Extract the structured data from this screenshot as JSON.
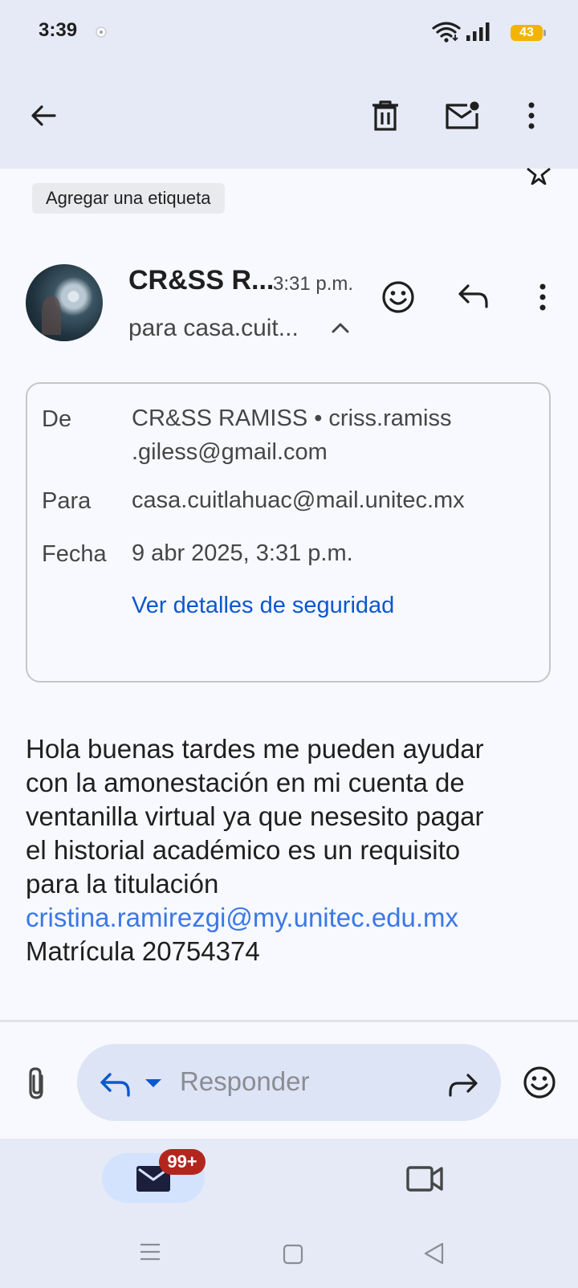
{
  "status_bar": {
    "time": "3:39",
    "battery": "43"
  },
  "toolbar": {
    "back_icon": "arrow-left-icon",
    "delete_icon": "trash-icon",
    "mark_unread_icon": "mail-unread-icon",
    "more_icon": "more-vertical-icon"
  },
  "email": {
    "add_label": "Agregar una etiqueta",
    "sender_short": "CR&SS R...",
    "time": "3:31 p.m.",
    "to_short": "para casa.cuit...",
    "details": {
      "from_label": "De",
      "from_value_line1": "CR&SS RAMISS • criss.ramiss",
      "from_value_line2": ".giless@gmail.com",
      "to_label": "Para",
      "to_value": "casa.cuitlahuac@mail.unitec.mx",
      "date_label": "Fecha",
      "date_value": "9 abr 2025, 3:31 p.m.",
      "security_link": "Ver detalles de seguridad"
    },
    "body": {
      "line1": "Hola buenas tardes me pueden ayudar",
      "line2": "con la amonestación en mi cuenta de",
      "line3": "ventanilla virtual ya que nesesito pagar",
      "line4": "el historial académico es un requisito",
      "line5": "para la titulación",
      "link": "cristina.ramirezgi@my.unitec.edu.mx",
      "line6": "Matrícula 20754374"
    }
  },
  "reply_bar": {
    "placeholder": "Responder"
  },
  "bottom_nav": {
    "mail_badge": "99+"
  },
  "colors": {
    "accent": "#0b57d0",
    "link": "#3b78e7",
    "badge": "#b3261e",
    "battery": "#f2b400",
    "top_bar": "#e6eaf6",
    "reply_pill": "#dde4f6"
  }
}
